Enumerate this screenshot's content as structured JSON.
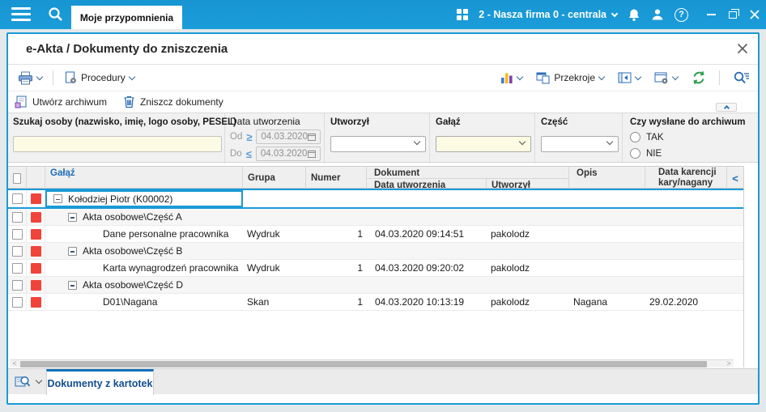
{
  "topbar": {
    "tab_label": "Moje przypomnienia",
    "company_selector": "2 - Nasza firma 0 - centrala"
  },
  "icons": {
    "help_glyph": "?",
    "od_compare": "≥",
    "do_compare": "≤",
    "collapse_left": "<",
    "scroll_left": "<",
    "scroll_right": ">"
  },
  "dialog": {
    "title": "e-Akta / Dokumenty do zniszczenia"
  },
  "toolbar": {
    "procedury_label": "Procedury",
    "przekroje_label": "Przekroje"
  },
  "actions": {
    "utworz_archiwum": "Utwórz archiwum",
    "zniszcz_dokumenty": "Zniszcz dokumenty"
  },
  "filters": {
    "szukaj_label": "Szukaj osoby (nazwisko, imię, logo osoby, PESEL)",
    "szukaj_value": "",
    "data_utworzenia_label": "Data utworzenia",
    "od_label": "Od",
    "od_value": "04.03.2020",
    "do_label": "Do",
    "do_value": "04.03.2020",
    "utworzyl_label": "Utworzył",
    "utworzyl_value": "",
    "galaz_label": "Gałąź",
    "galaz_value": "",
    "czesc_label": "Część",
    "czesc_value": "",
    "archiwum_label": "Czy wysłane do archiwum",
    "tak_label": "TAK",
    "nie_label": "NIE"
  },
  "table": {
    "headers": {
      "galaz": "Gałąź",
      "grupa": "Grupa",
      "numer": "Numer",
      "dokument": "Dokument",
      "data_utworzenia": "Data utworzenia",
      "utworzyl": "Utworzył",
      "opis": "Opis",
      "karencja_l1": "Data karencji",
      "karencja_l2": "kary/nagany"
    },
    "rows": [
      {
        "galaz": "Kołodziej Piotr (K00002)",
        "grupa": "",
        "numer": "",
        "data_utworzenia": "",
        "utworzyl": "",
        "opis": "",
        "karencja": ""
      },
      {
        "galaz": "Akta osobowe\\Część A",
        "grupa": "",
        "numer": "",
        "data_utworzenia": "",
        "utworzyl": "",
        "opis": "",
        "karencja": ""
      },
      {
        "galaz": "Dane personalne pracownika",
        "grupa": "Wydruk",
        "numer": "1",
        "data_utworzenia": "04.03.2020 09:14:51",
        "utworzyl": "pakolodz",
        "opis": "",
        "karencja": ""
      },
      {
        "galaz": "Akta osobowe\\Część B",
        "grupa": "",
        "numer": "",
        "data_utworzenia": "",
        "utworzyl": "",
        "opis": "",
        "karencja": ""
      },
      {
        "galaz": "Karta wynagrodzeń pracownika",
        "grupa": "Wydruk",
        "numer": "1",
        "data_utworzenia": "04.03.2020 09:20:02",
        "utworzyl": "pakolodz",
        "opis": "",
        "karencja": ""
      },
      {
        "galaz": "Akta osobowe\\Część D",
        "grupa": "",
        "numer": "",
        "data_utworzenia": "",
        "utworzyl": "",
        "opis": "",
        "karencja": ""
      },
      {
        "galaz": "D01\\Nagana",
        "grupa": "Skan",
        "numer": "1",
        "data_utworzenia": "04.03.2020 10:13:19",
        "utworzyl": "pakolodz",
        "opis": "Nagana",
        "karencja": "29.02.2020"
      }
    ]
  },
  "bottom_tabs": {
    "active_tab": "Dokumenty z kartotek"
  },
  "colors": {
    "accent_blue": "#1a9ad7",
    "toolbar_icon_blue": "#2b6cb8",
    "refresh_green": "#2f9e4f",
    "red_flag": "#f0433a",
    "input_yellow": "#fdfbe3"
  }
}
